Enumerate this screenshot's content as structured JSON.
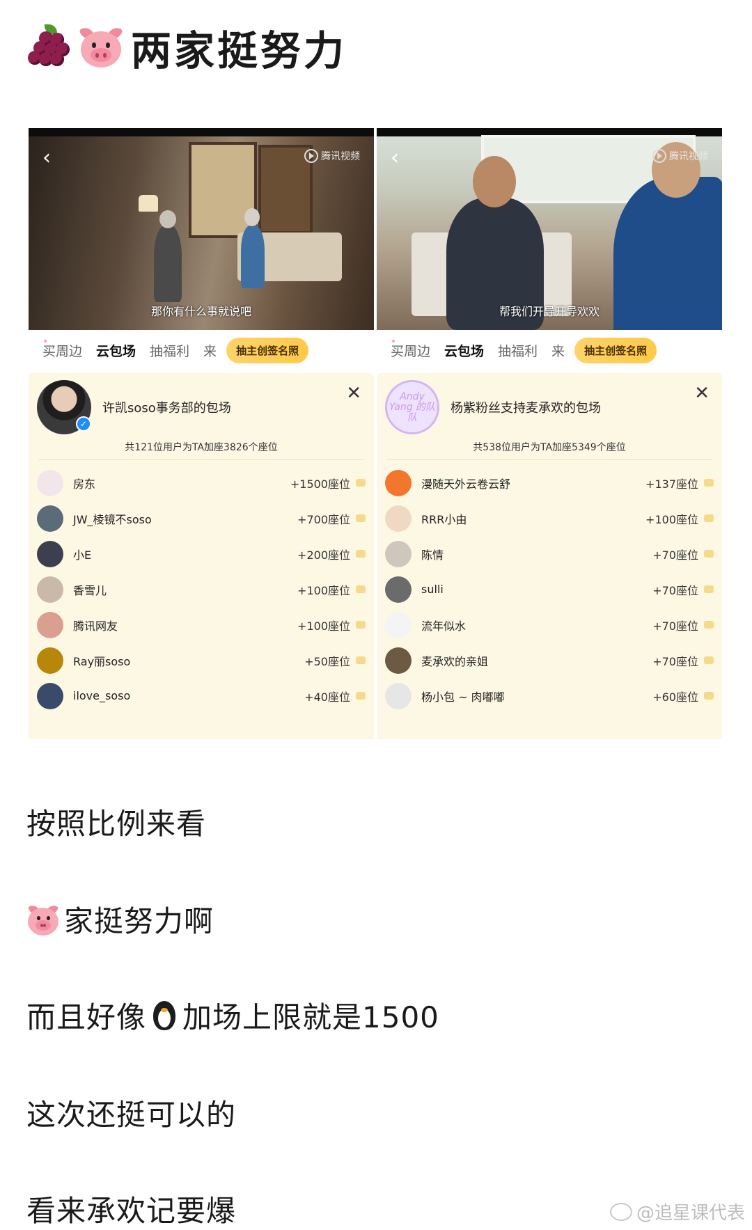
{
  "title": {
    "text": "两家挺努力",
    "emojis": [
      "grapes-icon",
      "pig-face-icon"
    ]
  },
  "panels": [
    {
      "video": {
        "watermark": "腾讯视频",
        "subtitle": "那你有什么事就说吧"
      },
      "tabs": [
        "买周边",
        "云包场",
        "抽福利",
        "来"
      ],
      "active_tab": "云包场",
      "cta": "抽主创签名照",
      "host_name": "许凯soso事务部的包场",
      "summary": "共121位用户为TA加座3826个座位",
      "rows": [
        {
          "name": "房东",
          "seats": "+1500座位",
          "color": "#f3e6ea"
        },
        {
          "name": "JW_棱镜不soso",
          "seats": "+700座位",
          "color": "#5b6b78"
        },
        {
          "name": "小E",
          "seats": "+200座位",
          "color": "#3c3f4e"
        },
        {
          "name": "香雪儿",
          "seats": "+100座位",
          "color": "#c9b9a6"
        },
        {
          "name": "腾讯网友",
          "seats": "+100座位",
          "color": "#d9a08f"
        },
        {
          "name": "Ray丽soso",
          "seats": "+50座位",
          "color": "#b8860b"
        },
        {
          "name": "ilove_soso",
          "seats": "+40座位",
          "color": "#3a4a6a"
        }
      ]
    },
    {
      "video": {
        "watermark": "腾讯视频",
        "subtitle": "帮我们开导开导欢欢"
      },
      "tabs": [
        "买周边",
        "云包场",
        "抽福利",
        "来"
      ],
      "active_tab": "云包场",
      "cta": "抽主创签名照",
      "host_name": "杨紫粉丝支持麦承欢的包场",
      "host_avatar_text": "Andy Yang 的队队",
      "summary": "共538位用户为TA加座5349个座位",
      "rows": [
        {
          "name": "漫随天外云卷云舒",
          "seats": "+137座位",
          "color": "#f2772c"
        },
        {
          "name": "RRR小由",
          "seats": "+100座位",
          "color": "#efd9c4"
        },
        {
          "name": "陈情",
          "seats": "+70座位",
          "color": "#cfc6bd"
        },
        {
          "name": "sulli",
          "seats": "+70座位",
          "color": "#6b6b6b"
        },
        {
          "name": "流年似水",
          "seats": "+70座位",
          "color": "#f4f4f4"
        },
        {
          "name": "麦承欢的亲姐",
          "seats": "+70座位",
          "color": "#6d5a44"
        },
        {
          "name": "杨小包 ~ 肉嘟嘟",
          "seats": "+60座位",
          "color": "#e6e6e6"
        }
      ]
    }
  ],
  "paragraphs": {
    "p1": "按照比例来看",
    "p2": "家挺努力啊",
    "p3a": "而且好像",
    "p3b": "加场上限就是1500",
    "p4": "这次还挺可以的",
    "p5": "看来承欢记要爆"
  },
  "footer": {
    "watermark": "@追星课代表"
  }
}
